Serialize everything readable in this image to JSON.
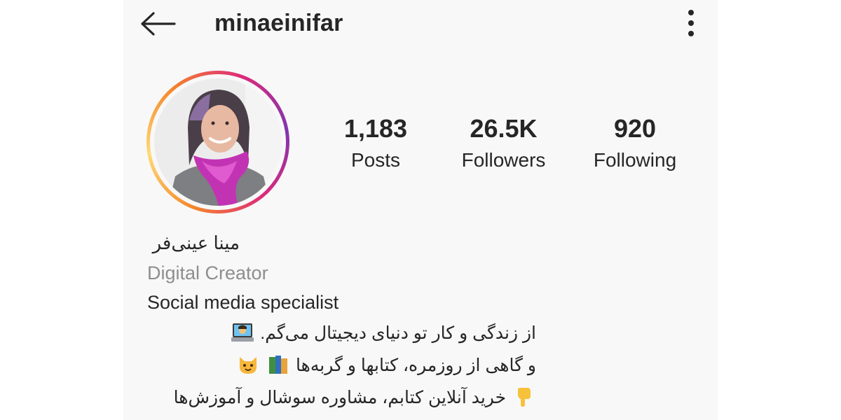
{
  "header": {
    "username": "minaeinifar"
  },
  "stats": {
    "posts": {
      "count": "1,183",
      "label": "Posts"
    },
    "followers": {
      "count": "26.5K",
      "label": "Followers"
    },
    "following": {
      "count": "920",
      "label": "Following"
    }
  },
  "bio": {
    "full_name": "مینا عینی‌فر",
    "category": "Digital Creator",
    "line1": "Social media specialist",
    "line2": "از زندگی و کار تو دنیای دیجیتال می‌گم.",
    "line3": "و گاهی از روزمره، کتابها و گربه‌ها",
    "line4": "خرید آنلاین کتابم، مشاوره سوشال و آموزش‌ها"
  },
  "colors": {
    "background": "#f8f8f8",
    "text": "#262626",
    "secondary_text": "#8e8e8e",
    "ring_gradient": [
      "#f58529",
      "#dd2a7b",
      "#8134af"
    ]
  },
  "icons": {
    "back": "arrow-left-icon",
    "more": "vertical-dots-icon",
    "line2_emoji": "technologist-emoji",
    "line3_emojis": [
      "cat-emoji",
      "books-emoji"
    ],
    "line4_emoji": "pointing-down-emoji"
  }
}
